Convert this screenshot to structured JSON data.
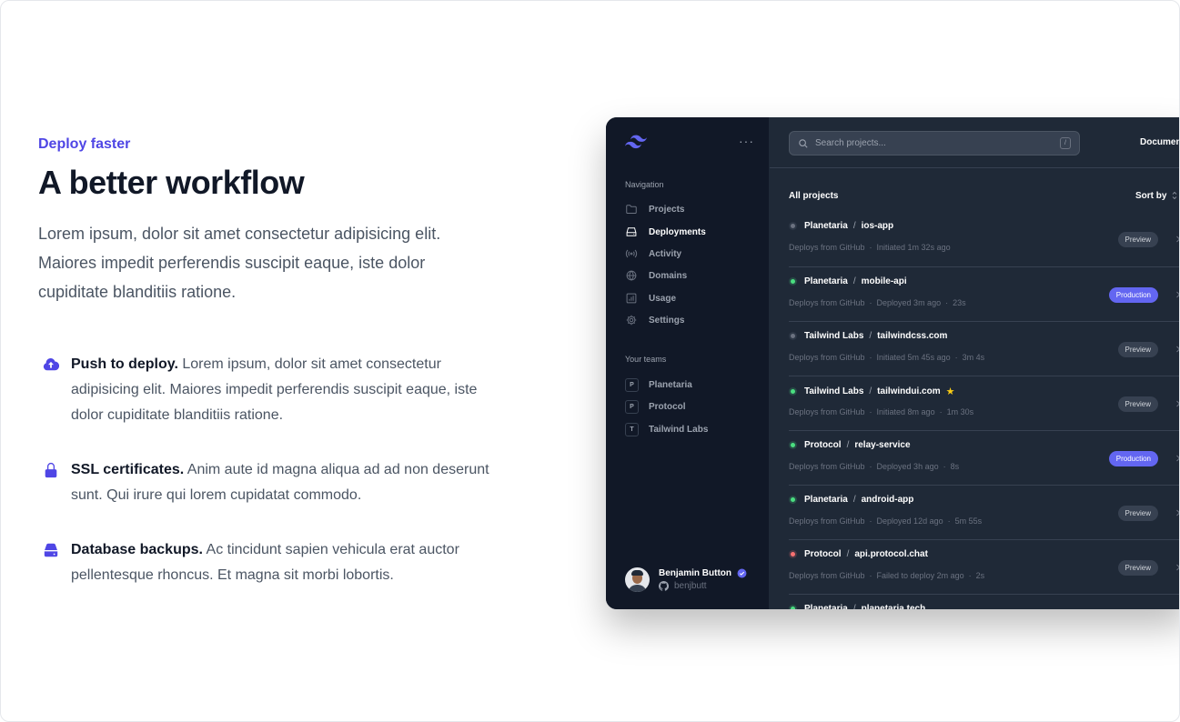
{
  "eyebrow": "Deploy faster",
  "headline": "A better workflow",
  "lead": "Lorem ipsum, dolor sit amet consectetur adipisicing elit. Maiores impedit perferendis suscipit eaque, iste dolor cupiditate blanditiis ratione.",
  "features": [
    {
      "title": "Push to deploy.",
      "text": " Lorem ipsum, dolor sit amet consectetur adipisicing elit. Maiores impedit perferendis suscipit eaque, iste dolor cupiditate blanditiis ratione.",
      "icon": "cloud-upload-icon"
    },
    {
      "title": "SSL certificates.",
      "text": " Anim aute id magna aliqua ad ad non deserunt sunt. Qui irure qui lorem cupidatat commodo.",
      "icon": "lock-icon"
    },
    {
      "title": "Database backups.",
      "text": " Ac tincidunt sapien vehicula erat auctor pellentesque rhoncus. Et magna sit morbi lobortis.",
      "icon": "server-icon"
    }
  ],
  "app": {
    "more_label": "···",
    "navigation_heading": "Navigation",
    "nav": [
      {
        "label": "Projects",
        "icon": "folder-icon"
      },
      {
        "label": "Deployments",
        "icon": "server-icon",
        "active": true
      },
      {
        "label": "Activity",
        "icon": "signal-icon"
      },
      {
        "label": "Domains",
        "icon": "globe-icon"
      },
      {
        "label": "Usage",
        "icon": "chart-bar-icon"
      },
      {
        "label": "Settings",
        "icon": "cog-icon"
      }
    ],
    "teams_heading": "Your teams",
    "teams": [
      {
        "initial": "P",
        "label": "Planetaria"
      },
      {
        "initial": "P",
        "label": "Protocol"
      },
      {
        "initial": "T",
        "label": "Tailwind Labs"
      }
    ],
    "user": {
      "name": "Benjamin Button",
      "handle": "benjbutt"
    },
    "search": {
      "placeholder": "Search projects...",
      "shortcut": "/"
    },
    "doc_link": "Documentation",
    "list_title": "All projects",
    "sort_label": "Sort by",
    "colors": {
      "accent": "#4f46e5",
      "production": "#6366f1",
      "success": "#4ade80",
      "error": "#f87171",
      "neutral": "#6b7280"
    },
    "projects": [
      {
        "team": "Planetaria",
        "name": "ios-app",
        "status": "neutral",
        "source": "Deploys from GitHub",
        "detail": "Initiated 1m 32s ago",
        "duration": "",
        "env": "Preview"
      },
      {
        "team": "Planetaria",
        "name": "mobile-api",
        "status": "success",
        "source": "Deploys from GitHub",
        "detail": "Deployed 3m ago",
        "duration": "23s",
        "env": "Production"
      },
      {
        "team": "Tailwind Labs",
        "name": "tailwindcss.com",
        "status": "neutral",
        "source": "Deploys from GitHub",
        "detail": "Initiated 5m 45s ago",
        "duration": "3m 4s",
        "env": "Preview"
      },
      {
        "team": "Tailwind Labs",
        "name": "tailwindui.com",
        "status": "success",
        "starred": true,
        "source": "Deploys from GitHub",
        "detail": "Initiated 8m ago",
        "duration": "1m 30s",
        "env": "Preview"
      },
      {
        "team": "Protocol",
        "name": "relay-service",
        "status": "success",
        "source": "Deploys from GitHub",
        "detail": "Deployed 3h ago",
        "duration": "8s",
        "env": "Production"
      },
      {
        "team": "Planetaria",
        "name": "android-app",
        "status": "success",
        "source": "Deploys from GitHub",
        "detail": "Deployed 12d ago",
        "duration": "5m 55s",
        "env": "Preview"
      },
      {
        "team": "Protocol",
        "name": "api.protocol.chat",
        "status": "error",
        "source": "Deploys from GitHub",
        "detail": "Failed to deploy 2m ago",
        "duration": "2s",
        "env": "Preview"
      },
      {
        "team": "Planetaria",
        "name": "planetaria.tech",
        "status": "success",
        "source": "",
        "detail": "",
        "duration": "",
        "env": ""
      }
    ]
  }
}
